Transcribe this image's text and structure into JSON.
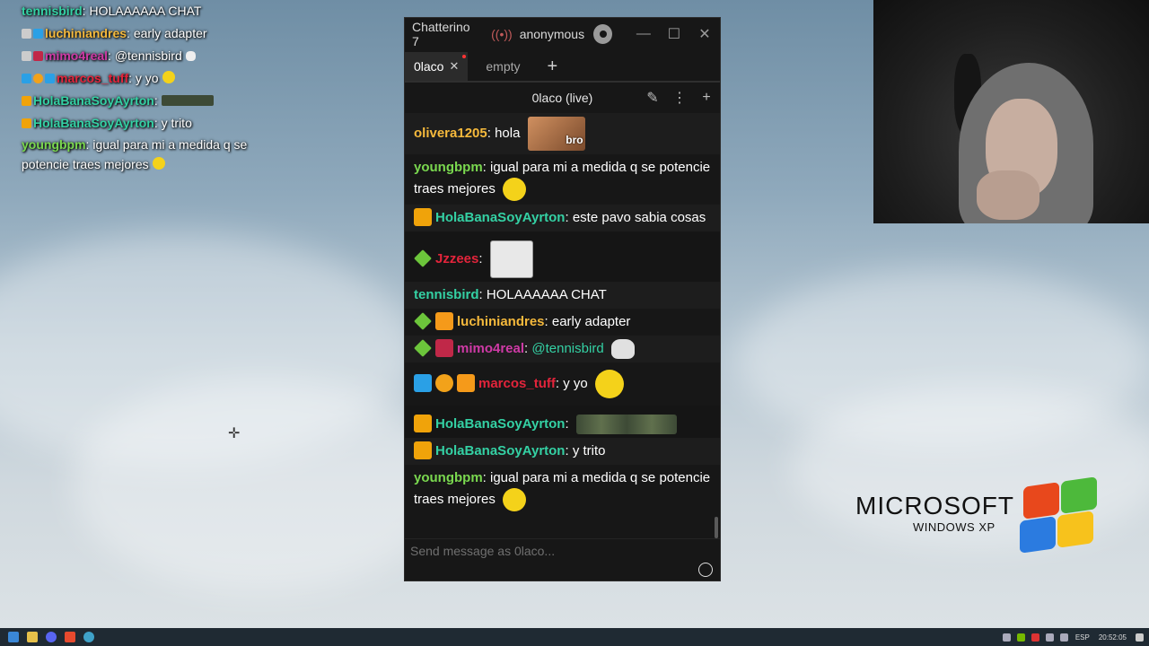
{
  "overlay_chat": [
    {
      "user": "tennisbird",
      "color": "#34d1a4",
      "text": "HOLAAAAAA CHAT",
      "badges": []
    },
    {
      "user": "luchiniandres",
      "color": "#f5b93c",
      "text": "early adapter",
      "badges": [
        "prime",
        "sub"
      ]
    },
    {
      "user": "mimo4real",
      "color": "#cf3aa6",
      "text": "@tennisbird",
      "badges": [
        "prime",
        "seven"
      ]
    },
    {
      "user": "marcos_tuff",
      "color": "#e3243b",
      "text": "y yo",
      "badges": [
        "hammer",
        "one",
        "sub"
      ]
    },
    {
      "user": "HolaBanaSoyAyrton",
      "color": "#34d1a4",
      "text": "",
      "badges": [
        "crown"
      ]
    },
    {
      "user": "HolaBanaSoyAyrton",
      "color": "#34d1a4",
      "text": "y trito",
      "badges": [
        "crown"
      ]
    },
    {
      "user": "youngbpm",
      "color": "#7ad84f",
      "text": "igual para mi a medida q se potencie traes mejores",
      "badges": []
    }
  ],
  "window": {
    "app_title": "Chatterino 7",
    "live_icon": "((•))",
    "account": "anonymous",
    "gear": "gear-icon",
    "minimize": "—",
    "maximize": "☐",
    "close": "✕"
  },
  "tabs": [
    {
      "label": "0laco",
      "close": "✕"
    },
    {
      "label": "empty"
    }
  ],
  "tab_add": "+",
  "split": {
    "title": "0laco (live)",
    "mod_icon": "✎",
    "menu_icon": "⋮",
    "add_icon": "+"
  },
  "messages": [
    {
      "user": "olivera1205",
      "color": "#f5b93c",
      "text": "hola",
      "emote": "bro",
      "emote_label": "bro"
    },
    {
      "user": "youngbpm",
      "color": "#7ad84f",
      "text": "igual para mi a medida q se potencie traes mejores"
    },
    {
      "user": "HolaBanaSoyAyrton",
      "color": "#34d1a4",
      "text": "este pavo sabia cosas"
    },
    {
      "user": "Jzzees",
      "color": "#e3243b",
      "text": ""
    },
    {
      "user": "tennisbird",
      "color": "#34d1a4",
      "text": "HOLAAAAAA CHAT"
    },
    {
      "user": "luchiniandres",
      "color": "#f5b93c",
      "text": "early adapter"
    },
    {
      "user": "mimo4real",
      "color": "#cf3aa6",
      "text": "@tennisbird"
    },
    {
      "user": "marcos_tuff",
      "color": "#e3243b",
      "text": "y yo"
    },
    {
      "user": "HolaBanaSoyAyrton",
      "color": "#34d1a4",
      "text": ""
    },
    {
      "user": "HolaBanaSoyAyrton",
      "color": "#34d1a4",
      "text": "y trito"
    },
    {
      "user": "youngbpm",
      "color": "#7ad84f",
      "text": "igual para mi a medida q se potencie traes mejores"
    }
  ],
  "input": {
    "placeholder": "Send message as 0laco..."
  },
  "desktop_logo": {
    "brand": "MICROSOFT",
    "product": "WINDOWS XP"
  },
  "taskbar": {
    "lang": "ESP",
    "time": "20:52:05"
  }
}
